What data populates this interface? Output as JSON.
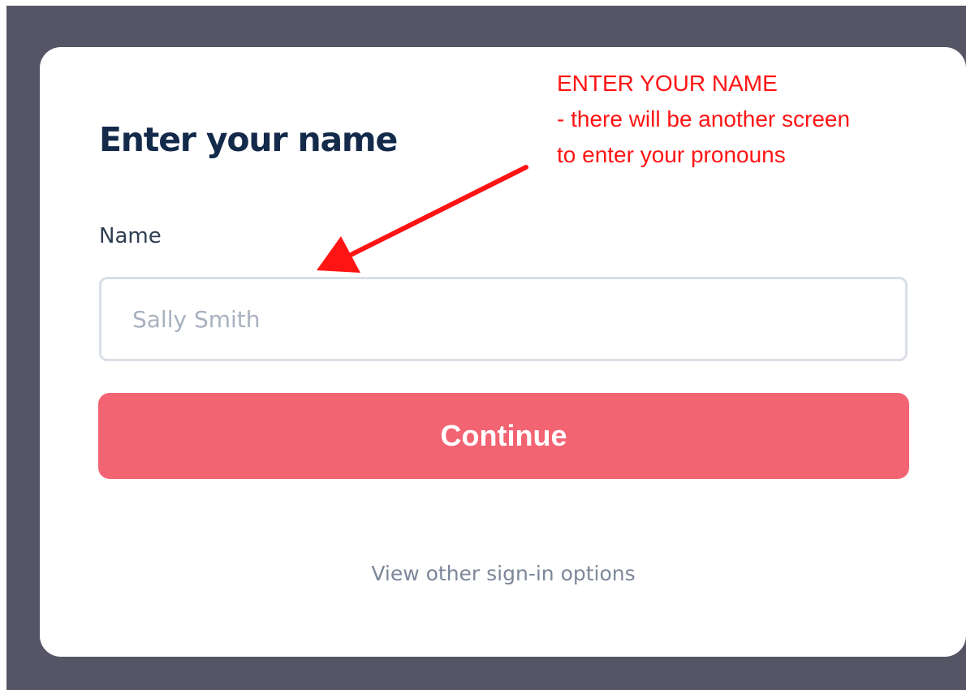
{
  "dialog": {
    "title": "Enter your name",
    "name_label": "Name",
    "name_value": "",
    "name_placeholder": "Sally Smith",
    "continue_label": "Continue",
    "other_options_label": "View other sign-in options"
  },
  "annotation": {
    "lines": [
      "ENTER YOUR NAME",
      "- there will be another screen",
      "to enter your pronouns"
    ],
    "color": "#ff1414"
  },
  "colors": {
    "backdrop": "#565565",
    "card": "#ffffff",
    "title": "#132a4a",
    "button": "#f26472",
    "button_text": "#ffffff",
    "link": "#7c8799",
    "input_border": "#dadfe6"
  },
  "icons": {
    "annotation_arrow": "arrow-icon"
  }
}
